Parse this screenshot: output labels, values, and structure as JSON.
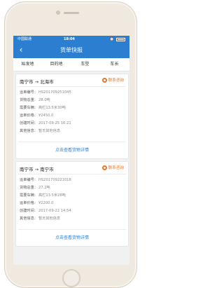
{
  "status": {
    "carrier": "中国联通",
    "time": "18:04"
  },
  "header": {
    "back_glyph": "‹",
    "title": "货单快报"
  },
  "tabs": [
    {
      "label": "始发地"
    },
    {
      "label": "目的地"
    },
    {
      "label": "车型"
    },
    {
      "label": "车长"
    }
  ],
  "cards": [
    {
      "route": "南宁市 → 北海市",
      "contact": "联系咨询",
      "rows": [
        {
          "label": "运单编号：",
          "value": "HS201709251045"
        },
        {
          "label": "货物总重：",
          "value": "28.0吨"
        },
        {
          "label": "需要车辆：",
          "value": "高栏13.5米30吨"
        },
        {
          "label": "运单价格：",
          "value": "¥2450.0"
        },
        {
          "label": "创建时间：",
          "value": "2017-09-25 16:21"
        },
        {
          "label": "其他信息：",
          "value": "暂无其他信息"
        }
      ],
      "detail": "点击查看货物详情"
    },
    {
      "route": "南宁市 → 南宁市",
      "contact": "联系咨询",
      "rows": [
        {
          "label": "运单编号：",
          "value": "HS201709221016"
        },
        {
          "label": "货物总重：",
          "value": "27.2吨"
        },
        {
          "label": "需要车辆：",
          "value": "高栏13.5米28吨"
        },
        {
          "label": "运单价格：",
          "value": "¥2200.0"
        },
        {
          "label": "创建时间：",
          "value": "2017-09-22 14:54"
        },
        {
          "label": "其他信息：",
          "value": "暂无其他信息"
        }
      ],
      "detail": "点击查看货物详情"
    }
  ]
}
